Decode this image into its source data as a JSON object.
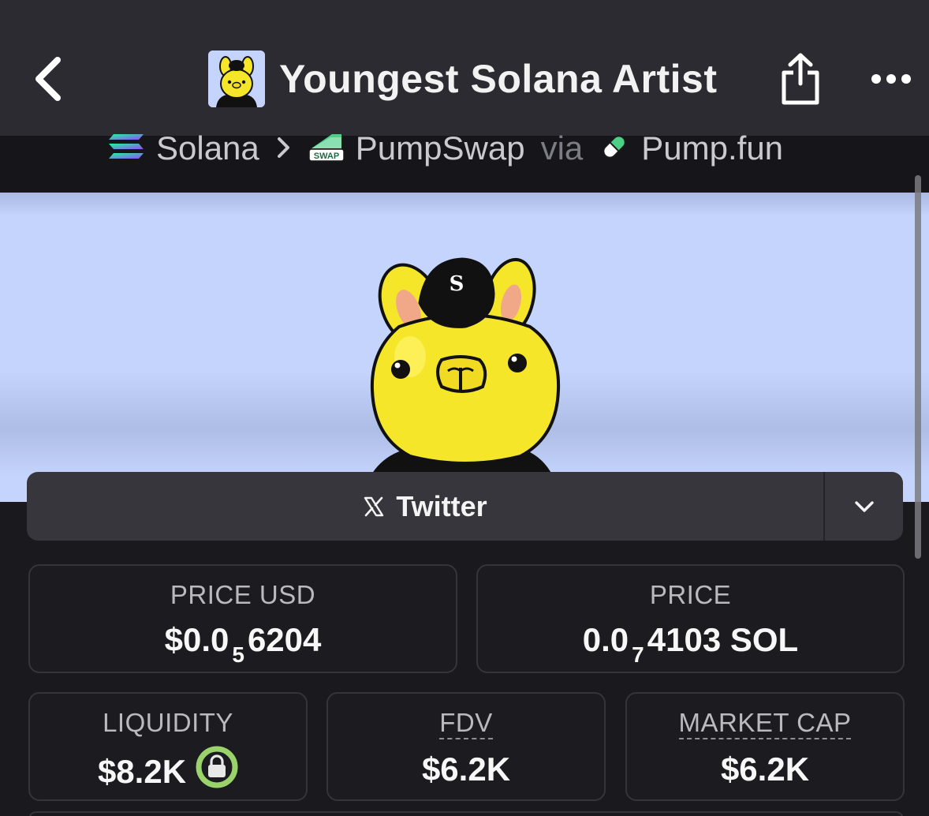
{
  "header": {
    "title": "Youngest Solana Artist",
    "back_icon": "chevron-left-icon",
    "share_icon": "share-icon",
    "more_icon": "ellipsis-icon"
  },
  "breadcrumb": {
    "chain": "Solana",
    "dex": "PumpSwap",
    "dex_badge": "SWAP",
    "via": "via",
    "launchpad": "Pump.fun"
  },
  "banner": {
    "background_color": "#c4d4fc",
    "cap_emblem": "S"
  },
  "social": {
    "label": "Twitter",
    "icon": "x-logo-icon",
    "dropdown_icon": "chevron-down-icon"
  },
  "stats": {
    "price_usd": {
      "label": "PRICE USD",
      "prefix": "$0.0",
      "zeros": "5",
      "digits": "6204"
    },
    "price_native": {
      "label": "PRICE",
      "prefix": "0.0",
      "zeros": "7",
      "digits": "4103",
      "unit": "SOL"
    },
    "liquidity": {
      "label": "LIQUIDITY",
      "value": "$8.2K",
      "lock_icon": "lock-icon"
    },
    "fdv": {
      "label": "FDV",
      "value": "$6.2K"
    },
    "market_cap": {
      "label": "MARKET CAP",
      "value": "$6.2K"
    }
  },
  "colors": {
    "nav_bg": "#2b2b31",
    "page_bg": "#19191e",
    "card_border": "#34343a",
    "lock_ring": "#9bd36b",
    "mascot_yellow": "#f5e62a"
  }
}
